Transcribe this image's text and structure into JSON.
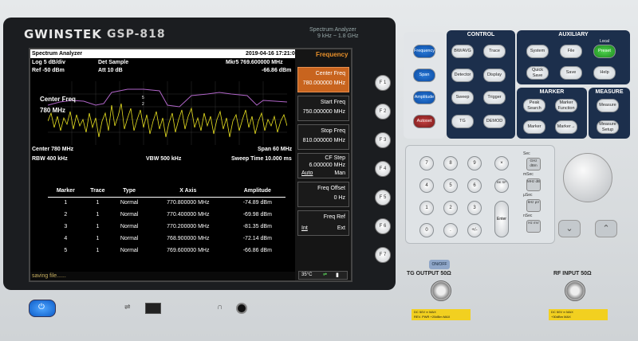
{
  "brand": {
    "name": "GWINSTEK",
    "model": "GSP-818",
    "desc1": "Spectrum Analyzer",
    "desc2": "9 kHz ~ 1.8 GHz"
  },
  "screen": {
    "title": "Spectrum Analyzer",
    "datetime": "2019-04-16 17:21:03",
    "menu_title": "Frequency",
    "scale": "Log 5 dB/div",
    "detector": "Det Sample",
    "marker_readout": "Mkr5  769.600000 MHz",
    "ref": "Ref -50 dBm",
    "atten": "Att 10 dB",
    "marker_level": "-66.86 dBm",
    "overlay_label": "Center Freq",
    "overlay_value": "780 MHz",
    "center": "Center 780 MHz",
    "span": "Span 60 MHz",
    "rbw": "RBW 400 kHz",
    "vbw": "VBW 500 kHz",
    "sweep": "Sweep Time 10.000 ms",
    "status": "saving file......",
    "temp": "35°C",
    "softkeys": [
      {
        "label": "Center Freq",
        "value": "780.000000 MHz"
      },
      {
        "label": "Start Freq",
        "value": "750.000000 MHz"
      },
      {
        "label": "Stop Freq",
        "value": "810.000000 MHz"
      },
      {
        "label": "CF Step",
        "value": "6.000000 MHz",
        "left": "Auto",
        "right": "Man"
      },
      {
        "label": "Freq Offset",
        "value": "0 Hz"
      },
      {
        "label": "Freq Ref",
        "left": "Int",
        "right": "Ext"
      }
    ],
    "table": {
      "headers": [
        "Marker",
        "Trace",
        "Type",
        "X Axis",
        "Amplitude"
      ],
      "rows": [
        [
          "1",
          "1",
          "Normal",
          "770.800000 MHz",
          "-74.89 dBm"
        ],
        [
          "2",
          "1",
          "Normal",
          "770.400000 MHz",
          "-69.98 dBm"
        ],
        [
          "3",
          "1",
          "Normal",
          "770.200000 MHz",
          "-81.35 dBm"
        ],
        [
          "4",
          "1",
          "Normal",
          "768.900000 MHz",
          "-72.14 dBm"
        ],
        [
          "5",
          "1",
          "Normal",
          "769.600000 MHz",
          "-66.86 dBm"
        ]
      ]
    }
  },
  "fkeys": [
    "F 1",
    "F 2",
    "F 3",
    "F 4",
    "F 5",
    "F 6",
    "F 7"
  ],
  "panel": {
    "left_buttons": [
      "Frequency",
      "Span",
      "Amplitude",
      "Autoset"
    ],
    "control": {
      "title": "CONTROL",
      "buttons": [
        "BW/AVG",
        "Trace",
        "Detector",
        "Display",
        "Sweep",
        "Trigger",
        "TG",
        "DEMOD"
      ]
    },
    "auxiliary": {
      "title": "AUXILIARY",
      "local": "Local",
      "buttons": [
        "System",
        "File",
        "Preset",
        "Quick Save",
        "Save",
        "Help"
      ]
    },
    "marker": {
      "title": "MARKER",
      "buttons": [
        "Peak Search",
        "Marker Function",
        "Marker",
        "Marker→"
      ]
    },
    "measure": {
      "title": "MEASURE",
      "buttons": [
        "Measure",
        "Measure Setup"
      ]
    }
  },
  "keypad": {
    "keys": [
      "7",
      "8",
      "9",
      "×",
      "4",
      "5",
      "6",
      "BK SP",
      "1",
      "2",
      "3",
      "0",
      ".",
      "+/-"
    ],
    "enter": "Enter",
    "units": [
      "GHz dBm",
      "MHz dB",
      "kHz µV",
      "Hz mV"
    ],
    "unit_titles": [
      "Sec",
      "mSec",
      "µSec",
      "nSec"
    ]
  },
  "bottom": {
    "tg_label": "TG  OUTPUT  50Ω",
    "rf_label": "RF  INPUT  50Ω",
    "onoff": "ON/OFF",
    "warn_tg": "DC 50V ═ MAX\nREV. PWR +20dBm MAX",
    "warn_rf": "DC 50V ═ MAX\n+30dBm MAX"
  }
}
